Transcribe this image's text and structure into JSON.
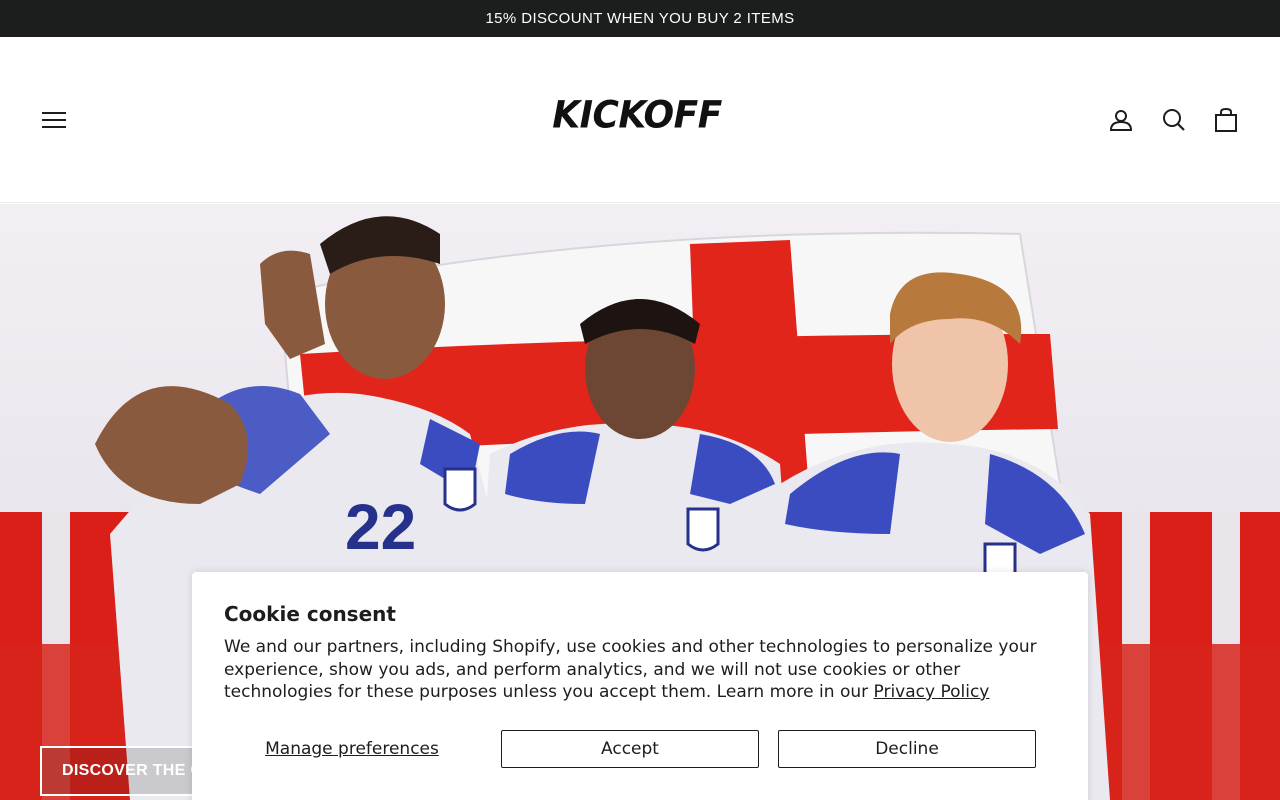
{
  "announcement": {
    "text": "15% DISCOUNT WHEN YOU BUY 2 ITEMS"
  },
  "header": {
    "logo_text": "KICKOFF",
    "icons": {
      "menu": "hamburger-menu-icon",
      "account": "user-icon",
      "search": "search-icon",
      "cart": "shopping-bag-icon"
    }
  },
  "hero": {
    "cta_label": "DISCOVER THE C",
    "colors": {
      "red": "#e1251b",
      "kit_blue": "#3b4cc0",
      "kit_white": "#e9e9ef"
    }
  },
  "cookie_consent": {
    "title": "Cookie consent",
    "body": "We and our partners, including Shopify, use cookies and other technologies to personalize your experience, show you ads, and perform analytics, and we will not use cookies or other technologies for these purposes unless you accept them. Learn more in our ",
    "privacy_link": "Privacy Policy",
    "manage_label": "Manage preferences",
    "accept_label": "Accept",
    "decline_label": "Decline"
  }
}
